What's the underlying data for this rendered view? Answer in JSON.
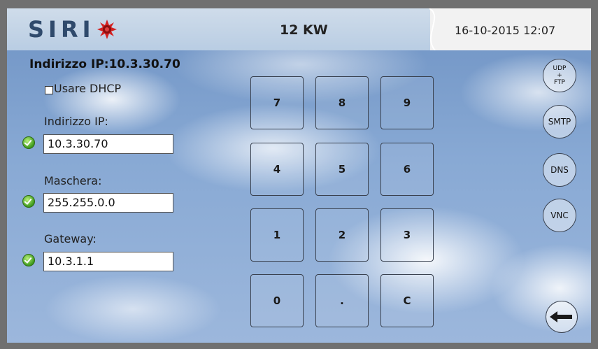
{
  "header": {
    "logo_text": "SIRI",
    "power": "12 KW",
    "datetime": "16-10-2015 12:07"
  },
  "network": {
    "title": "Indirizzo IP:10.3.30.70",
    "dhcp_label": "Usare DHCP",
    "dhcp_checked": false,
    "ip_label": "Indirizzo IP:",
    "ip_value": "10.3.30.70",
    "mask_label": "Maschera:",
    "mask_value": "255.255.0.0",
    "gateway_label": "Gateway:",
    "gateway_value": "10.3.1.1"
  },
  "keypad": [
    "7",
    "8",
    "9",
    "4",
    "5",
    "6",
    "1",
    "2",
    "3",
    "0",
    ".",
    "C"
  ],
  "side_buttons": {
    "udp_ftp": "UDP\n+\nFTP",
    "smtp": "SMTP",
    "dns": "DNS",
    "vnc": "VNC"
  },
  "icons": {
    "logo": "red-star-logo-icon",
    "check": "green-check-icon",
    "back": "arrow-left-icon"
  },
  "colors": {
    "logo_text": "#2f4a6c",
    "logo_star": "#d42020",
    "check": "#3e9b1e"
  }
}
